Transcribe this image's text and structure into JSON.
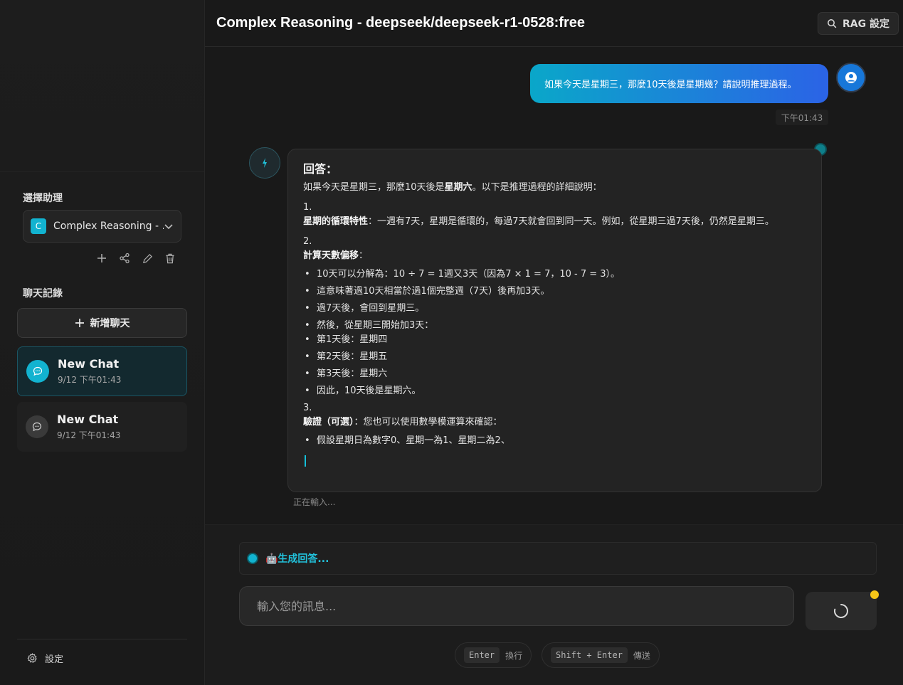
{
  "sidebar": {
    "assistant_section_label": "選擇助理",
    "assistant_badge": "C",
    "assistant_name": "Complex Reasoning - ...",
    "history_section_label": "聊天記錄",
    "new_chat_label": "新增聊天",
    "chats": [
      {
        "title": "New Chat",
        "time": "9/12 下午01:43",
        "active": true
      },
      {
        "title": "New Chat",
        "time": "9/12 下午01:43",
        "active": false
      }
    ],
    "settings_label": "設定"
  },
  "header": {
    "title": "Complex Reasoning - deepseek/deepseek-r1-0528:free",
    "rag_button_label": "RAG 設定"
  },
  "messages": {
    "user": {
      "text": "如果今天是星期三，那麼10天後是星期幾？請說明推理過程。",
      "time": "下午01:43"
    },
    "assistant": {
      "heading": "回答：",
      "intro_prefix": "如果今天是星期三，那麼10天後是",
      "intro_bold": "星期六",
      "intro_suffix": "。以下是推理過程的詳細說明：",
      "sections": [
        {
          "num": "1.",
          "bold": "星期的循環特性",
          "text": "：一週有7天，星期是循環的，每過7天就會回到同一天。例如，從星期三過7天後，仍然是星期三。"
        },
        {
          "num": "2.",
          "bold": "計算天數偏移",
          "text": "："
        },
        {
          "num": "3.",
          "bold": "驗證（可選）",
          "text": "：您也可以使用數學模運算來確認："
        }
      ],
      "section2_items": [
        "10天可以分解為：10 ÷ 7 = 1週又3天（因為7 × 1 = 7，10 - 7 = 3）。",
        "這意味著過10天相當於過1個完整週（7天）後再加3天。",
        "過7天後，會回到星期三。",
        "然後，從星期三開始加3天：",
        "第1天後：星期四",
        "第2天後：星期五",
        "第3天後：星期六",
        "因此，10天後是星期六。"
      ],
      "section3_items": [
        "假設星期日為數字0、星期一為1、星期二為2、"
      ],
      "typing_label": "正在輸入..."
    }
  },
  "input": {
    "generating_label": "🤖生成回答...",
    "placeholder": "輸入您的訊息...",
    "hint1_key": "Enter",
    "hint1_label": "換行",
    "hint2_key": "Shift + Enter",
    "hint2_label": "傳送"
  },
  "colors": {
    "accent": "#12b3d0",
    "user_bubble_start": "#0aa7c9",
    "user_bubble_end": "#2b63e6",
    "indicator_yellow": "#f5c518"
  }
}
